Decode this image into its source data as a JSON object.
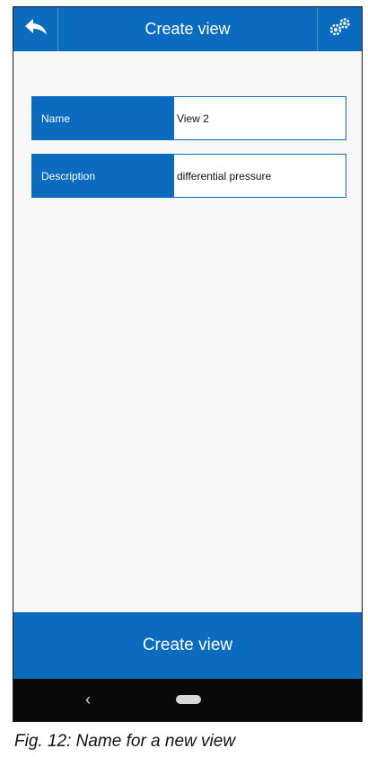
{
  "header": {
    "title": "Create view",
    "back_icon": "back-arrow-icon",
    "settings_icon": "gears-icon"
  },
  "form": {
    "name": {
      "label": "Name",
      "value": "View 2"
    },
    "description": {
      "label": "Description",
      "value": "differential pressure"
    }
  },
  "actions": {
    "create_label": "Create view"
  },
  "system_nav": {
    "back_glyph": "‹"
  },
  "caption": "Fig. 12: Name for a new view",
  "colors": {
    "accent": "#0b6bbf",
    "background": "#f8f8f8",
    "nav_bar": "#0a0a0a"
  }
}
